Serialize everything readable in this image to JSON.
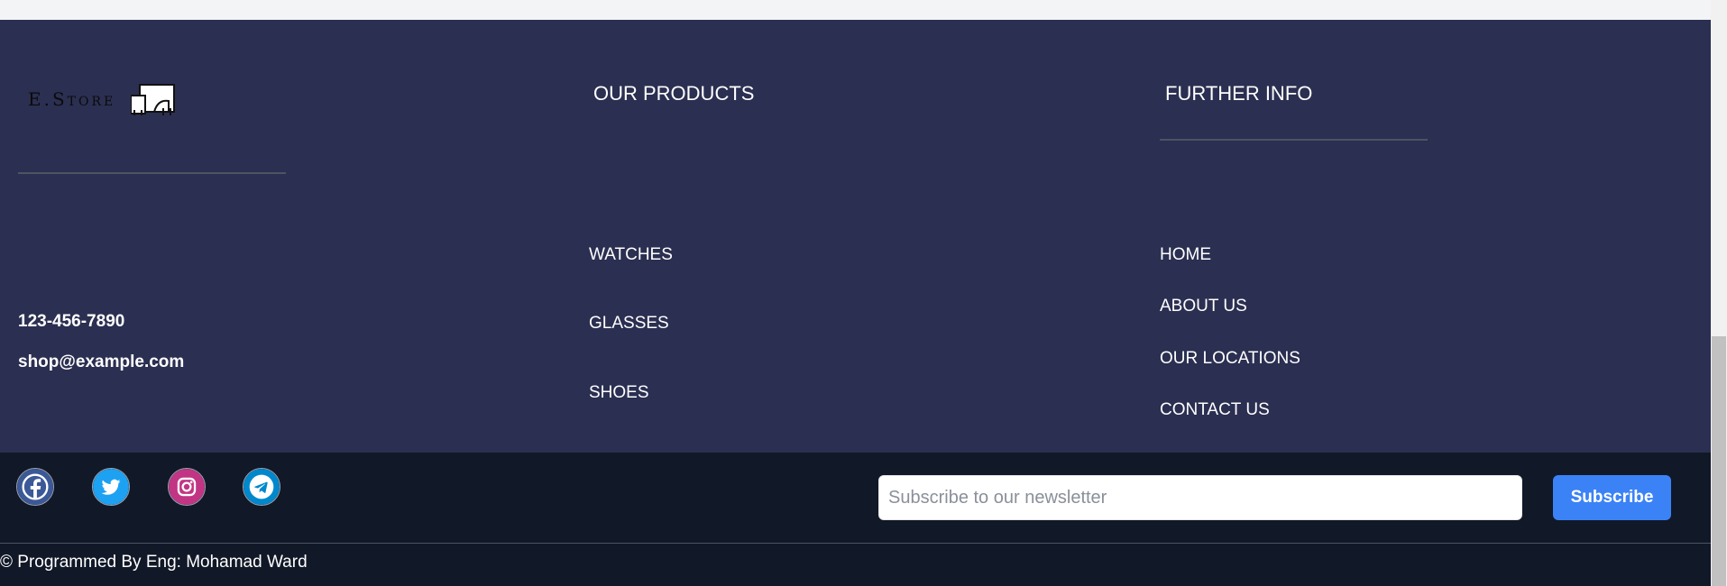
{
  "brand": {
    "logo_text": "E.Store"
  },
  "products": {
    "heading": "OUR PRODUCTS",
    "items": [
      "WATCHES",
      "GLASSES",
      "SHOES"
    ]
  },
  "further_info": {
    "heading": "FURTHER INFO",
    "items": [
      "HOME",
      "ABOUT US",
      "OUR LOCATIONS",
      "CONTACT US"
    ]
  },
  "contact": {
    "phone": "123-456-7890",
    "email": "shop@example.com"
  },
  "social": [
    {
      "name": "facebook",
      "icon": "facebook-icon",
      "color": "#3b5998"
    },
    {
      "name": "twitter",
      "icon": "twitter-icon",
      "color": "#1da1f2"
    },
    {
      "name": "instagram",
      "icon": "instagram-icon",
      "color": "#c13584"
    },
    {
      "name": "telegram",
      "icon": "telegram-icon",
      "color": "#0088cc"
    }
  ],
  "newsletter": {
    "placeholder": "Subscribe to our newsletter",
    "button_label": "Subscribe"
  },
  "footer": {
    "copyright": "© Programmed By Eng: Mohamad Ward"
  },
  "colors": {
    "footer_bg": "#2b2f51",
    "bottom_bg": "#111827",
    "accent": "#3b82f6"
  }
}
